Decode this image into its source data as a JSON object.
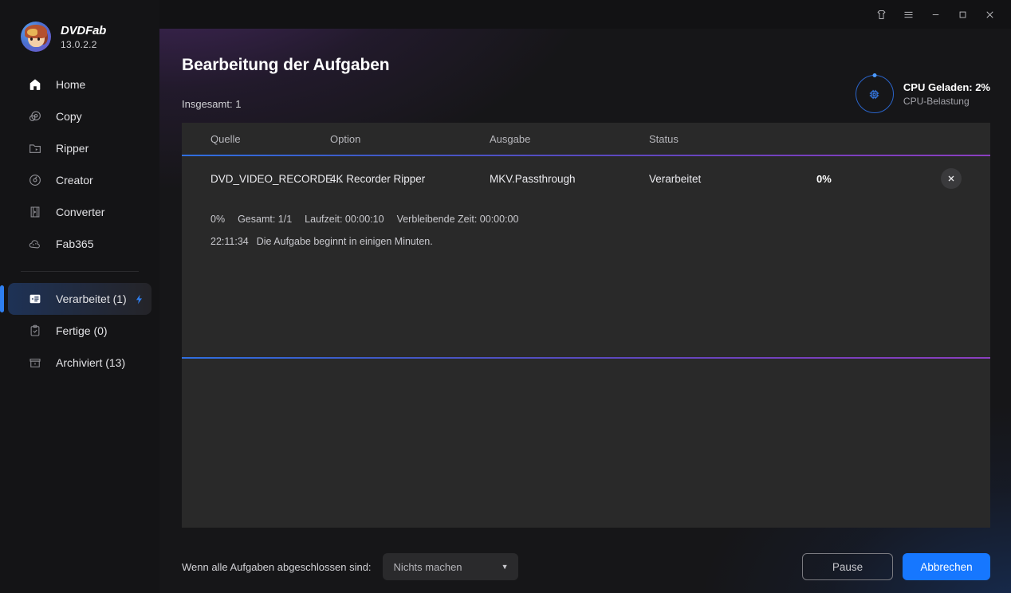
{
  "brand": {
    "name": "DVDFab",
    "version": "13.0.2.2",
    "avatar_icon": "user-avatar"
  },
  "sidebar": {
    "items": [
      {
        "label": "Home",
        "icon": "home-icon"
      },
      {
        "label": "Copy",
        "icon": "copy-disc-icon"
      },
      {
        "label": "Ripper",
        "icon": "folder-play-icon"
      },
      {
        "label": "Creator",
        "icon": "disc-icon"
      },
      {
        "label": "Converter",
        "icon": "film-strip-icon"
      },
      {
        "label": "Fab365",
        "icon": "cloud-icon"
      }
    ],
    "queue_items": [
      {
        "label": "Verarbeitet (1)",
        "icon": "task-list-icon",
        "active": true,
        "badge_icon": "lightning-bolt-icon"
      },
      {
        "label": "Fertige (0)",
        "icon": "clipboard-check-icon",
        "active": false
      },
      {
        "label": "Archiviert (13)",
        "icon": "archive-box-icon",
        "active": false
      }
    ]
  },
  "titlebar": {
    "buttons": [
      {
        "name": "theme-icon",
        "glyph": "theme"
      },
      {
        "name": "menu-icon",
        "glyph": "menu"
      },
      {
        "name": "minimize-icon",
        "glyph": "minimize"
      },
      {
        "name": "maximize-icon",
        "glyph": "maximize"
      },
      {
        "name": "close-icon",
        "glyph": "close"
      }
    ]
  },
  "header": {
    "title": "Bearbeitung der Aufgaben",
    "subtitle": "Insgesamt: 1"
  },
  "cpu": {
    "title": "CPU Geladen: 2%",
    "subtitle": "CPU-Belastung",
    "percent": 2,
    "icon": "cpu-chip-icon",
    "ring_color": "#2a63c8",
    "accent_color": "#4d9bff"
  },
  "table": {
    "columns": [
      "Quelle",
      "Option",
      "Ausgabe",
      "Status",
      "",
      ""
    ],
    "rows": [
      {
        "source": "DVD_VIDEO_RECORDE...",
        "option": "4K Recorder Ripper",
        "output": "MKV.Passthrough",
        "status": "Verarbeitet",
        "progress": "0%",
        "close_icon": "close-task-icon"
      }
    ]
  },
  "detail": {
    "progress": "0%",
    "total_label": "Gesamt: 1/1",
    "runtime_label": "Laufzeit: 00:00:10",
    "remaining_label": "Verbleibende Zeit: 00:00:00",
    "log_time": "22:11:34",
    "log_message": "Die Aufgabe beginnt in einigen Minuten."
  },
  "footer": {
    "label": "Wenn alle Aufgaben abgeschlossen sind:",
    "select_value": "Nichts machen",
    "select_options": [
      "Nichts machen"
    ],
    "pause_label": "Pause",
    "cancel_label": "Abbrechen",
    "primary_color": "#1677ff"
  }
}
